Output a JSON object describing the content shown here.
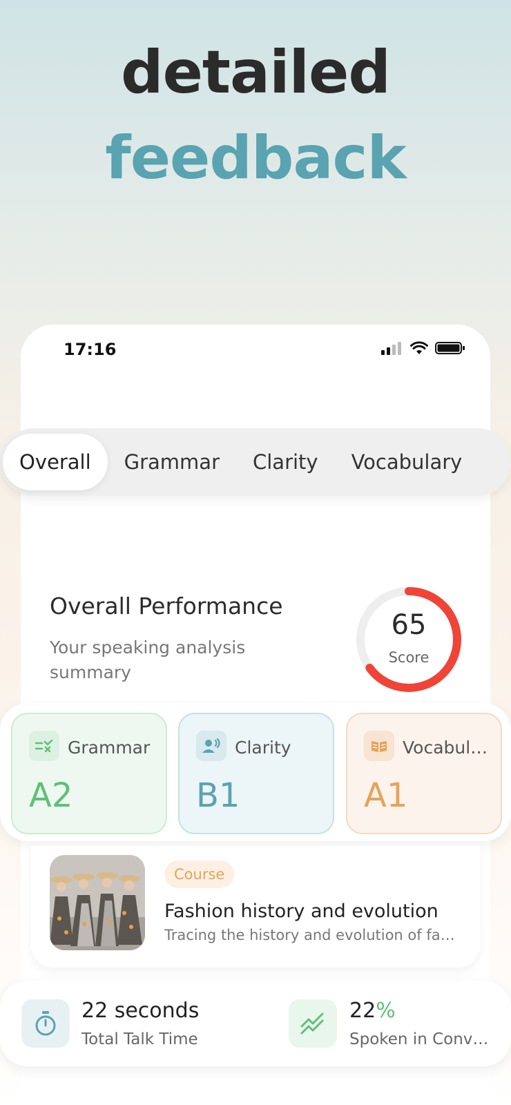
{
  "hero": {
    "line1": "detailed",
    "line2": "feedback"
  },
  "status_bar": {
    "time": "17:16"
  },
  "tabs": [
    {
      "label": "Overall"
    },
    {
      "label": "Grammar"
    },
    {
      "label": "Clarity"
    },
    {
      "label": "Vocabulary"
    }
  ],
  "performance": {
    "title": "Overall Performance",
    "subtitle": "Your speaking analysis summary",
    "score": "65",
    "score_label": "Score",
    "score_fraction": 0.65
  },
  "skills": [
    {
      "label": "Grammar",
      "level": "A2",
      "color": "#5fbf7a",
      "icon": "grammar-check-icon"
    },
    {
      "label": "Clarity",
      "level": "B1",
      "color": "#5aa3b0",
      "icon": "speaking-person-icon"
    },
    {
      "label": "Vocabul…",
      "level": "A1",
      "color": "#e6a35a",
      "icon": "open-book-icon"
    }
  ],
  "course": {
    "tag": "Course",
    "title": "Fashion history and evolution",
    "description": "Tracing the history and evolution of fa…"
  },
  "stats": [
    {
      "value": "22 seconds",
      "label": "Total Talk Time",
      "icon": "stopwatch-icon"
    },
    {
      "value_num": "22",
      "value_unit": "%",
      "label": "Spoken in Conv…",
      "icon": "trend-icon"
    }
  ],
  "colors": {
    "accent": "#5aa3b0",
    "gauge": "#f04438",
    "green": "#5fbf7a",
    "orange": "#e6a35a"
  }
}
